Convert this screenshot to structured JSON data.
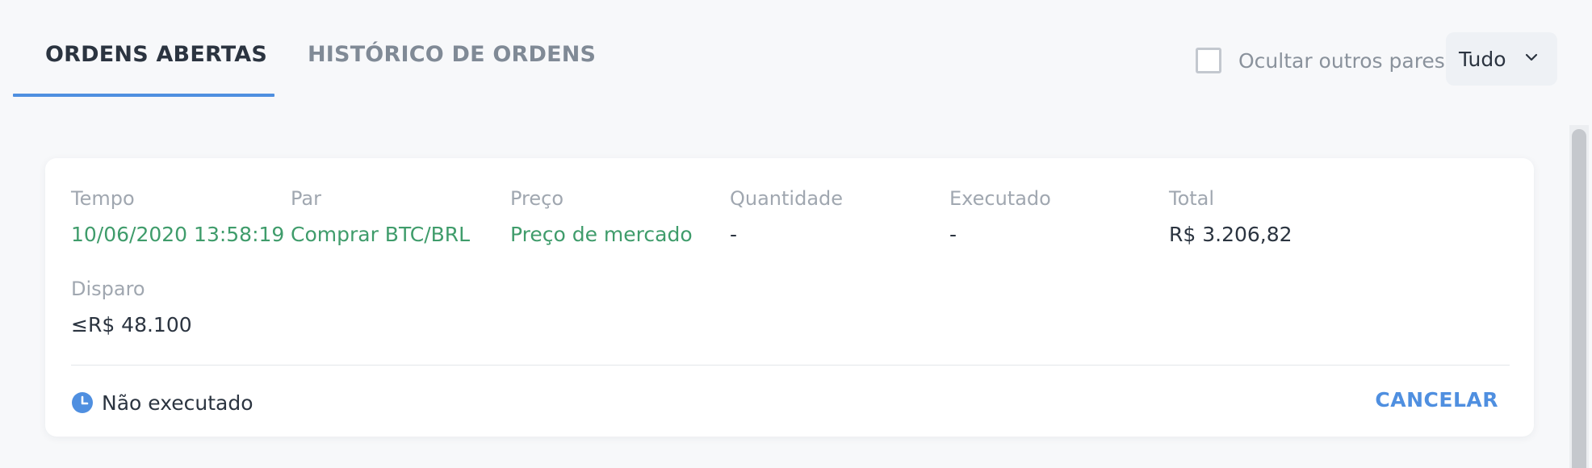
{
  "tabs": {
    "open_orders": "ORDENS ABERTAS",
    "order_history": "HISTÓRICO DE ORDENS",
    "active": "open_orders"
  },
  "filters": {
    "hide_other_pairs_label": "Ocultar outros pares",
    "hide_other_pairs_checked": false,
    "type_select_value": "Tudo"
  },
  "order": {
    "columns": {
      "time_label": "Tempo",
      "pair_label": "Par",
      "price_label": "Preço",
      "quantity_label": "Quantidade",
      "executed_label": "Executado",
      "total_label": "Total",
      "trigger_label": "Disparo"
    },
    "time": "10/06/2020 13:58:19",
    "pair": "Comprar BTC/BRL",
    "price": "Preço de mercado",
    "quantity": "-",
    "executed": "-",
    "total": "R$ 3.206,82",
    "trigger": "≤R$ 48.100",
    "status": "Não executado",
    "cancel_label": "CANCELAR"
  },
  "icons": {
    "status": "clock-icon",
    "select": "chevron-down-icon"
  },
  "colors": {
    "accent": "#4f8fe0",
    "buy_green": "#3f9c6b",
    "text_dark": "#2b3440",
    "text_muted": "#a0a7b0",
    "background": "#f7f8fa"
  }
}
